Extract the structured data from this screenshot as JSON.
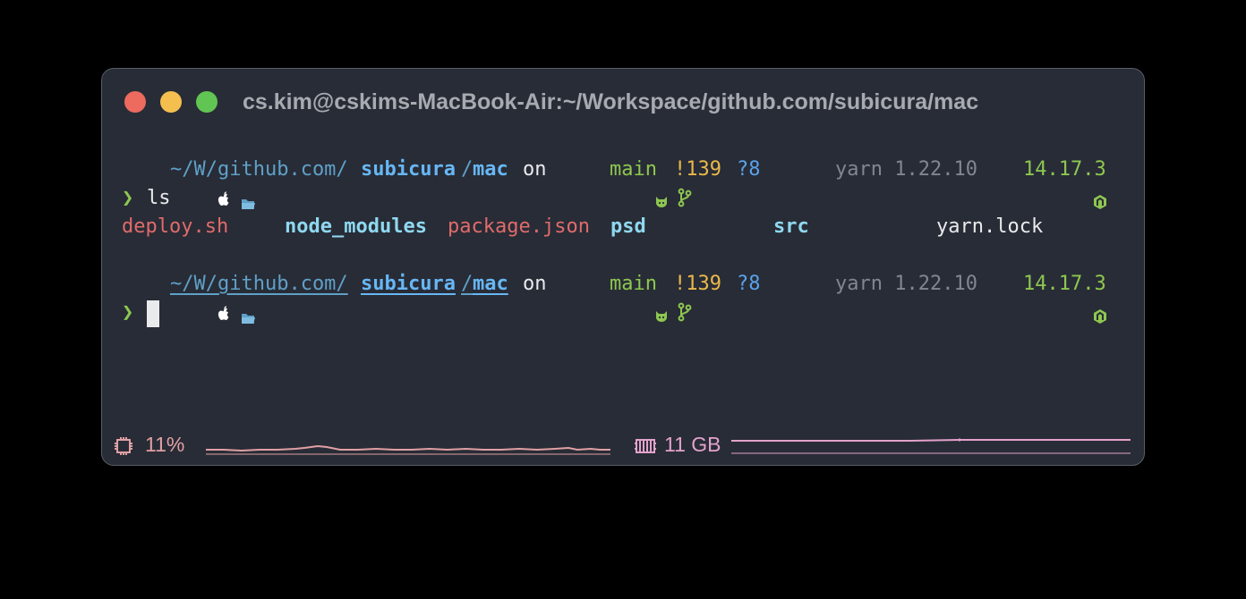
{
  "window": {
    "title": "cs.kim@cskims-MacBook-Air:~/Workspace/github.com/subicura/mac",
    "lights": {
      "close": "#ed6a5e",
      "minimize": "#f5bf4f",
      "zoom": "#61c554"
    }
  },
  "colors": {
    "bg": "#282c36",
    "path": "#5fa0c8",
    "path_bold": "#67b7f5",
    "git": "#8ec750",
    "modified": "#e9b84a",
    "untracked": "#5aa2eb",
    "dim": "#818690",
    "exec_file": "#e06b6b",
    "dir": "#8fd8f0",
    "text": "#e9eaec",
    "cpu": "#e0a0a4",
    "mem": "#e3a2cc"
  },
  "prompt1": {
    "apple_icon": "apple-icon",
    "folder_icon": "folder-icon",
    "path_dim": "~/W/github.com/",
    "path_repo": "subicura",
    "path_sep": "/",
    "path_dir": "mac",
    "on": "on",
    "github_icon": "github-cat-icon",
    "branch_icon": "git-branch-icon",
    "branch": "main",
    "modified": "!139",
    "untracked": "?8",
    "yarn": "yarn 1.22.10",
    "node_icon": "node-icon",
    "node_version": "14.17.3"
  },
  "command1": {
    "arrow": "❯",
    "text": "ls"
  },
  "ls_output": [
    "deploy.sh",
    "node_modules",
    "package.json",
    "psd",
    "src",
    "yarn.lock"
  ],
  "prompt2": {
    "path_dim": "~/W/github.com/",
    "path_repo": "subicura",
    "path_sep": "/",
    "path_dir": "mac",
    "on": "on",
    "branch": "main",
    "modified": "!139",
    "untracked": "?8",
    "yarn": "yarn 1.22.10",
    "node_version": "14.17.3"
  },
  "command2": {
    "arrow": "❯",
    "text": ""
  },
  "status_bar": {
    "cpu_icon": "cpu-chip-icon",
    "cpu": "11%",
    "mem_icon": "memory-icon",
    "mem": "11 GB"
  }
}
